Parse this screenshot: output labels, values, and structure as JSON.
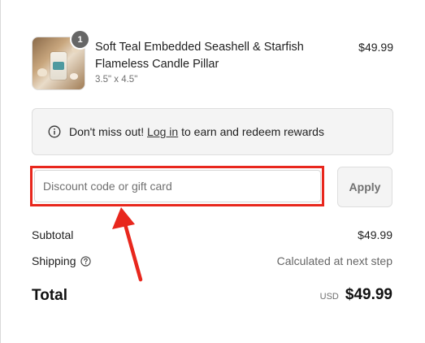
{
  "cart_item": {
    "quantity": "1",
    "name": "Soft Teal Embedded Seashell & Starfish Flameless Candle Pillar",
    "variant": "3.5\" x 4.5\"",
    "price": "$49.99"
  },
  "rewards": {
    "prefix": "Don't miss out!",
    "link_label": "Log in",
    "suffix": "to earn and redeem rewards",
    "icon": "info-icon"
  },
  "discount": {
    "placeholder": "Discount code or gift card",
    "value": "",
    "apply_label": "Apply",
    "highlight_color": "#e8271d"
  },
  "summary": {
    "subtotal_label": "Subtotal",
    "subtotal_value": "$49.99",
    "shipping_label": "Shipping",
    "shipping_value": "Calculated at next step",
    "total_label": "Total",
    "currency": "USD",
    "total_value": "$49.99"
  }
}
